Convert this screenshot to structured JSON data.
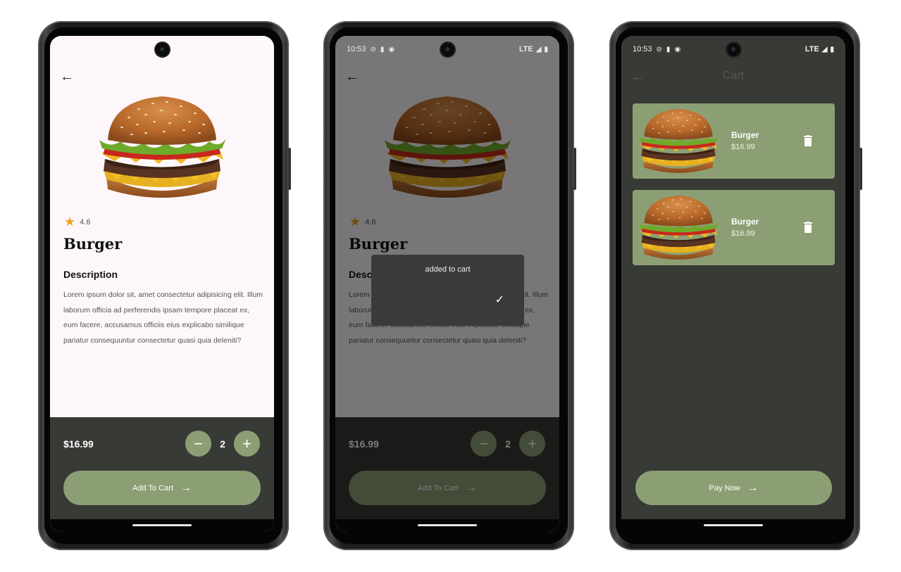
{
  "status": {
    "time": "10:53",
    "network": "LTE"
  },
  "detail": {
    "rating": "4.6",
    "title": "Burger",
    "description_heading": "Description",
    "description": "Lorem ipsum dolor sit, amet consectetur adipisicing elit. Illum laborum officia ad perferendis ipsam tempore placeat ex, eum facere, accusamus officiis eius explicabo similique pariatur consequuntur consectetur quasi quia deleniti?",
    "price": "$16.99",
    "quantity": "2",
    "add_to_cart_label": "Add To Cart",
    "minus_symbol": "−",
    "plus_symbol": "+"
  },
  "toast": {
    "message": "added to cart"
  },
  "cart": {
    "title": "Cart",
    "items": [
      {
        "name": "Burger",
        "price": "$16.99"
      },
      {
        "name": "Burger",
        "price": "$16.99"
      }
    ],
    "pay_label": "Pay Now"
  },
  "colors": {
    "accent": "#8c9f74",
    "dark": "#383a36",
    "light_bg": "#fdf7fb",
    "star": "#f0a020"
  },
  "icons": [
    "back-arrow-icon",
    "star-icon",
    "minus-icon",
    "plus-icon",
    "arrow-right-icon",
    "check-icon",
    "trash-icon",
    "camera-icon"
  ]
}
